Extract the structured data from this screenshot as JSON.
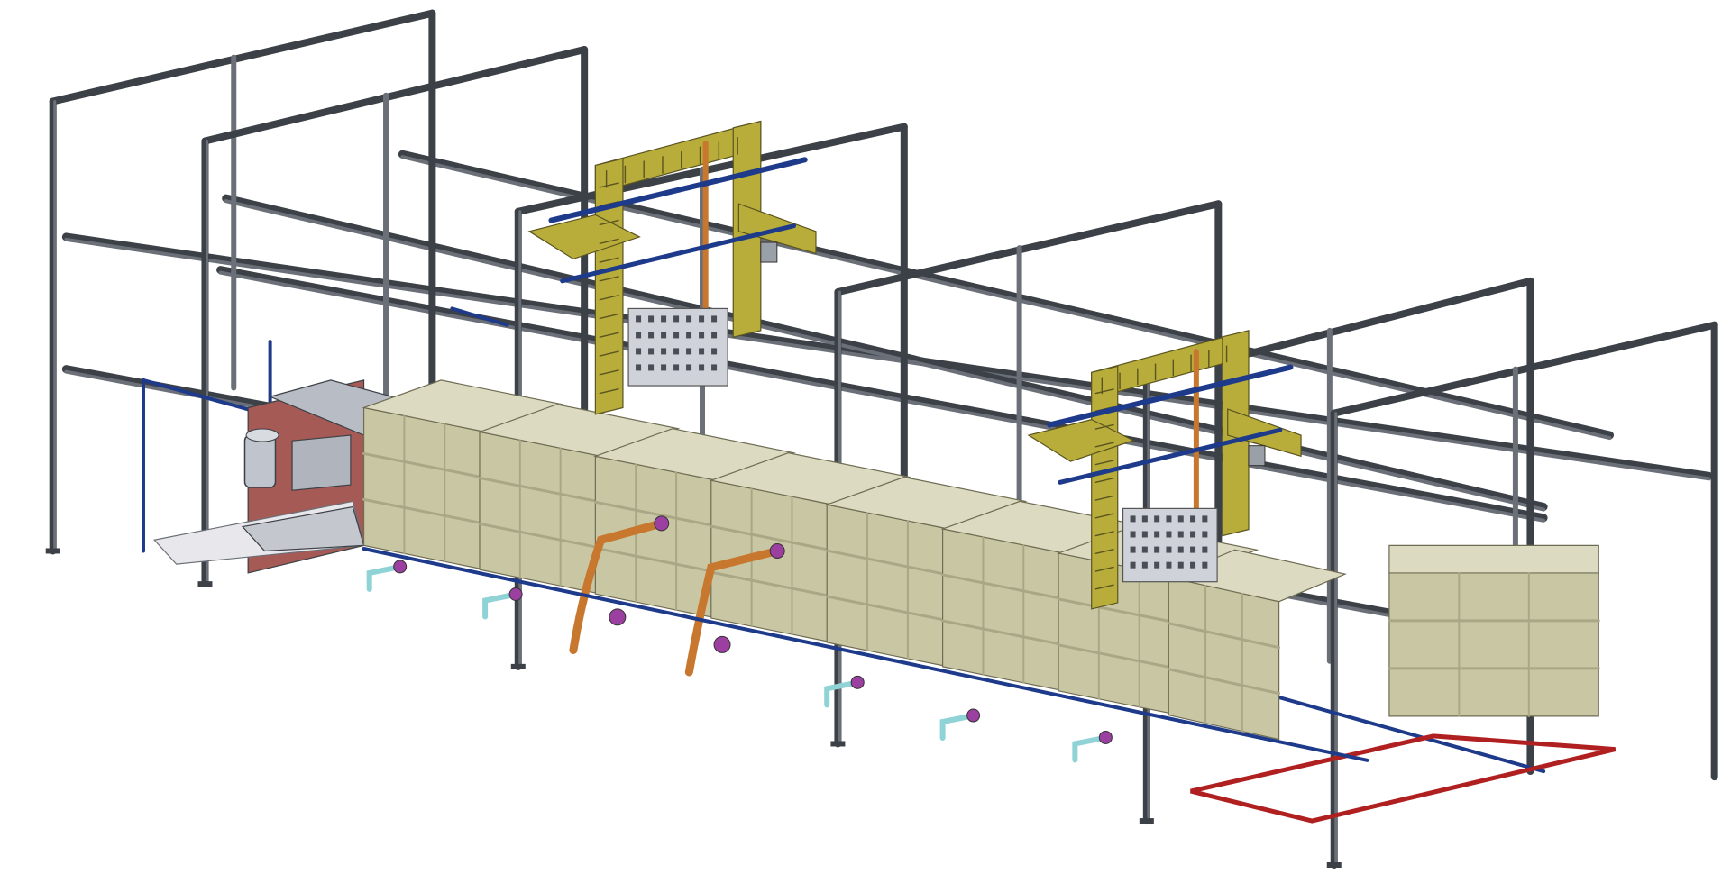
{
  "scene": {
    "subject": "electroplating-line-cad-render",
    "colors": {
      "background": "#ffffff",
      "frame_steel": "#6b7078",
      "frame_steel_dark": "#3c4047",
      "rail_blue": "#1e3a8a",
      "tank_body": "#c9c7a3",
      "tank_shade": "#a9a786",
      "tank_top": "#dcdac0",
      "gantry_yellow": "#b8ad3a",
      "gantry_dark": "#5a5420",
      "pipe_orange": "#c8782e",
      "valve_purple": "#9b3fa0",
      "fitting_cyan": "#8fd3d6",
      "hood_red": "#a65a55",
      "base_red": "#b02020",
      "grey_panel": "#b8bcc4"
    },
    "icons": [
      "gantry-crane-icon",
      "plating-tank-icon",
      "pump-motor-icon",
      "drain-valve-icon"
    ]
  }
}
